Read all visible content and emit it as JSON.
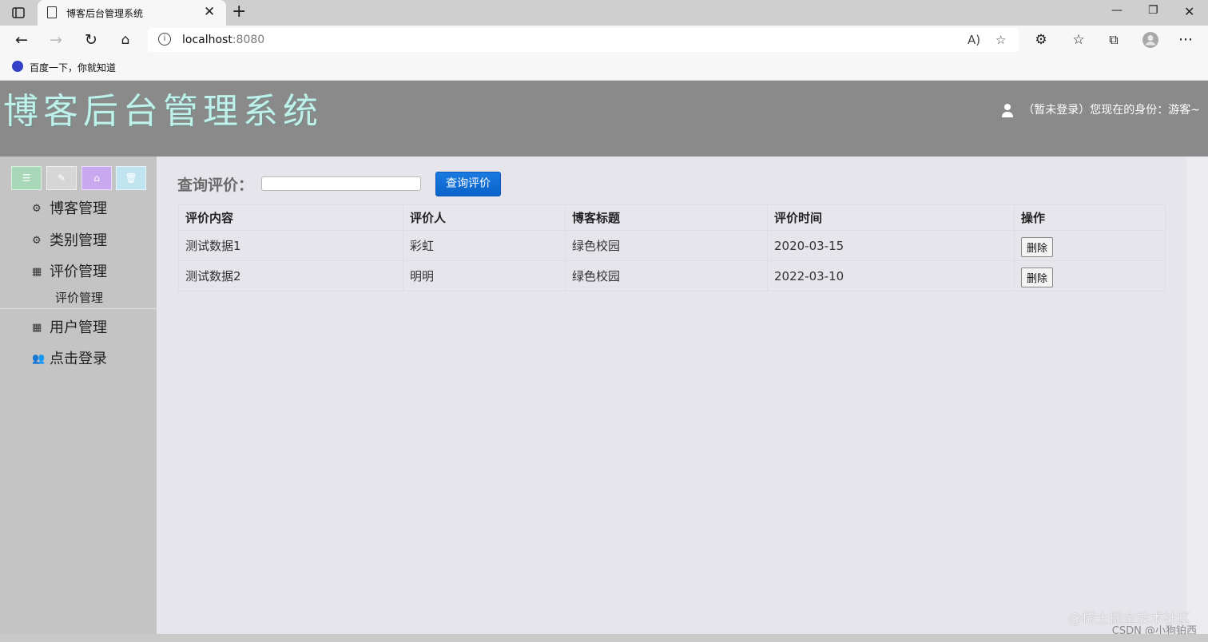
{
  "browser": {
    "tab_title": "博客后台管理系统",
    "url_host": "localhost",
    "url_port": ":8080",
    "bookmark": "百度一下，你就知道"
  },
  "header": {
    "title": "博客后台管理系统",
    "user_status": "（暂未登录）您现在的身份：游客~"
  },
  "sidebar": {
    "items": [
      {
        "label": "博客管理",
        "icon": "gears-icon"
      },
      {
        "label": "类别管理",
        "icon": "gears-icon"
      },
      {
        "label": "评价管理",
        "icon": "grid-icon"
      },
      {
        "label": "用户管理",
        "icon": "grid-icon"
      },
      {
        "label": "点击登录",
        "icon": "users-icon"
      }
    ],
    "sub_item": "评价管理",
    "quick_colors": [
      "#a8d8b8",
      "#d6d6d6",
      "#c9a8f0",
      "#bfe4f0"
    ]
  },
  "search": {
    "label": "查询评价：",
    "button": "查询评价",
    "value": ""
  },
  "table": {
    "headers": [
      "评价内容",
      "评价人",
      "博客标题",
      "评价时间",
      "操作"
    ],
    "rows": [
      {
        "content": "测试数据1",
        "reviewer": "彩虹",
        "blog_title": "绿色校园",
        "time": "2020-03-15",
        "action": "删除"
      },
      {
        "content": "测试数据2",
        "reviewer": "明明",
        "blog_title": "绿色校园",
        "time": "2022-03-10",
        "action": "删除"
      }
    ]
  },
  "watermark": {
    "line1": "@稀土掘金技术社区",
    "line2": "CSDN @小狗铂西"
  }
}
